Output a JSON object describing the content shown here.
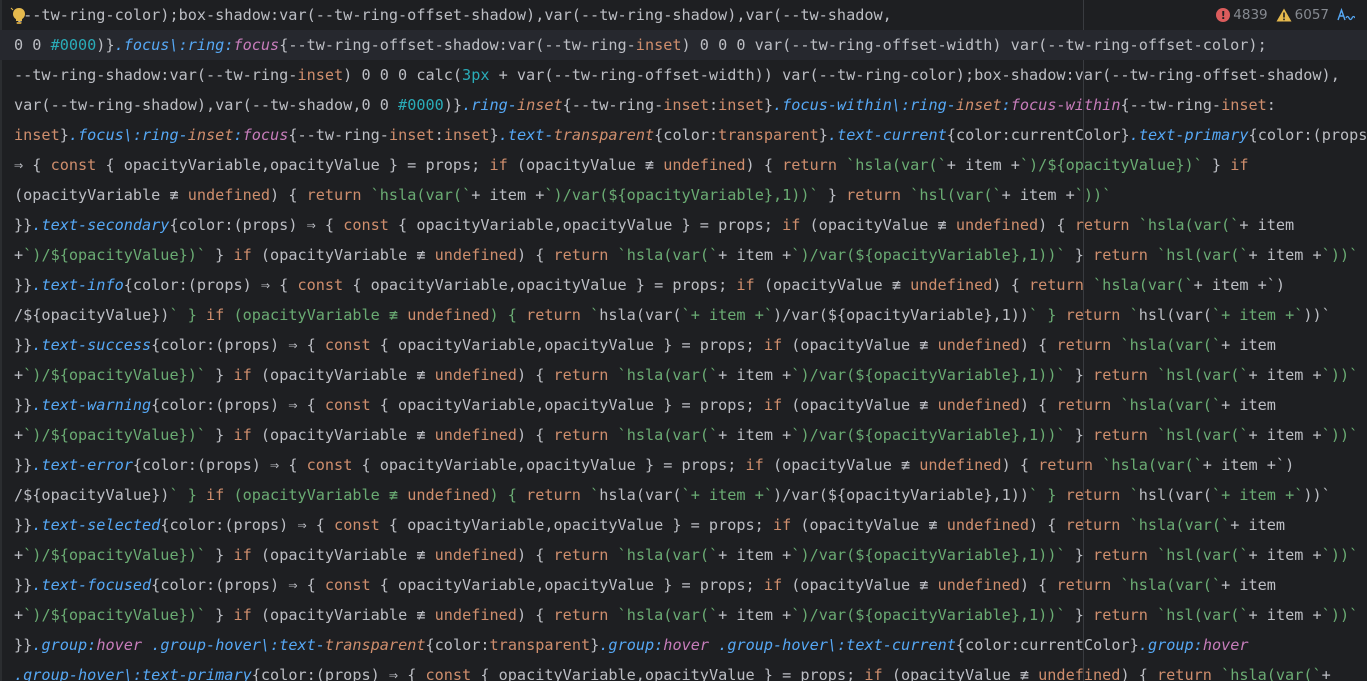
{
  "editor": {
    "lines": [
      "{--tw-ring-color);box-shadow:var(--tw-ring-offset-shadow),var(--tw-ring-shadow),var(--tw-shadow,",
      "0 0 #0000)}.focus\\:ring:focus{--tw-ring-offset-shadow:var(--tw-ring-inset) 0 0 0 var(--tw-ring-offset-width) var(--tw-ring-offset-color);",
      "--tw-ring-shadow:var(--tw-ring-inset) 0 0 0 calc(3px + var(--tw-ring-offset-width)) var(--tw-ring-color);box-shadow:var(--tw-ring-offset-shadow),",
      "var(--tw-ring-shadow),var(--tw-shadow,0 0 #0000)}.ring-inset{--tw-ring-inset:inset}.focus-within\\:ring-inset:focus-within{--tw-ring-inset:",
      "inset}.focus\\:ring-inset:focus{--tw-ring-inset:inset}.text-transparent{color:transparent}.text-current{color:currentColor}.text-primary{color:(props)",
      "⇒ { const { opacityVariable,opacityValue } = props; if (opacityValue ≢ undefined) { return `hsla(var(`+ item +`)/${opacityValue})` } if",
      "(opacityVariable ≢ undefined) { return `hsla(var(`+ item +`)/var(${opacityVariable},1))` } return `hsl(var(`+ item +`))`",
      "}}.text-secondary{color:(props) ⇒ { const { opacityVariable,opacityValue } = props; if (opacityValue ≢ undefined) { return `hsla(var(`+ item",
      "+`)/${opacityValue})` } if (opacityVariable ≢ undefined) { return `hsla(var(`+ item +`)/var(${opacityVariable},1))` } return `hsl(var(`+ item +`))`",
      "}}.text-info{color:(props) ⇒ { const { opacityVariable,opacityValue } = props; if (opacityValue ≢ undefined) { return `hsla(var(`+ item +`)",
      "/${opacityValue})` } if (opacityVariable ≢ undefined) { return `hsla(var(`+ item +`)/var(${opacityVariable},1))` } return `hsl(var(`+ item +`))`",
      "}}.text-success{color:(props) ⇒ { const { opacityVariable,opacityValue } = props; if (opacityValue ≢ undefined) { return `hsla(var(`+ item",
      "+`)/${opacityValue})` } if (opacityVariable ≢ undefined) { return `hsla(var(`+ item +`)/var(${opacityVariable},1))` } return `hsl(var(`+ item +`))`",
      "}}.text-warning{color:(props) ⇒ { const { opacityVariable,opacityValue } = props; if (opacityValue ≢ undefined) { return `hsla(var(`+ item",
      "+`)/${opacityValue})` } if (opacityVariable ≢ undefined) { return `hsla(var(`+ item +`)/var(${opacityVariable},1))` } return `hsl(var(`+ item +`))`",
      "}}.text-error{color:(props) ⇒ { const { opacityVariable,opacityValue } = props; if (opacityValue ≢ undefined) { return `hsla(var(`+ item +`)",
      "/${opacityValue})` } if (opacityVariable ≢ undefined) { return `hsla(var(`+ item +`)/var(${opacityVariable},1))` } return `hsl(var(`+ item +`))`",
      "}}.text-selected{color:(props) ⇒ { const { opacityVariable,opacityValue } = props; if (opacityValue ≢ undefined) { return `hsla(var(`+ item",
      "+`)/${opacityValue})` } if (opacityVariable ≢ undefined) { return `hsla(var(`+ item +`)/var(${opacityVariable},1))` } return `hsl(var(`+ item +`))`",
      "}}.text-focused{color:(props) ⇒ { const { opacityVariable,opacityValue } = props; if (opacityValue ≢ undefined) { return `hsla(var(`+ item",
      "+`)/${opacityValue})` } if (opacityVariable ≢ undefined) { return `hsla(var(`+ item +`)/var(${opacityVariable},1))` } return `hsl(var(`+ item +`))`",
      "}}.group:hover .group-hover\\:text-transparent{color:transparent}.group:hover .group-hover\\:text-current{color:currentColor}.group:hover",
      ".group-hover\\:text-primary{color:(props) ⇒ { const { opacityVariable,opacityValue } = props; if (opacityValue ≢ undefined) { return `hsla(var(`+"
    ],
    "current_line_index": 1
  },
  "inspections": {
    "errors": "4839",
    "warnings": "6057",
    "typos_icon": "typo-icon",
    "error_icon": "error-icon",
    "warning_icon": "warning-icon"
  },
  "colors": {
    "background": "#1e1f22",
    "current_line": "#26282e",
    "text": "#bcbec4",
    "keyword": "#cf8e6d",
    "selector": "#56a8f5",
    "pseudo": "#c77dbb",
    "number": "#2aacb8",
    "error": "#db5c5c",
    "warning": "#e5b94d"
  }
}
